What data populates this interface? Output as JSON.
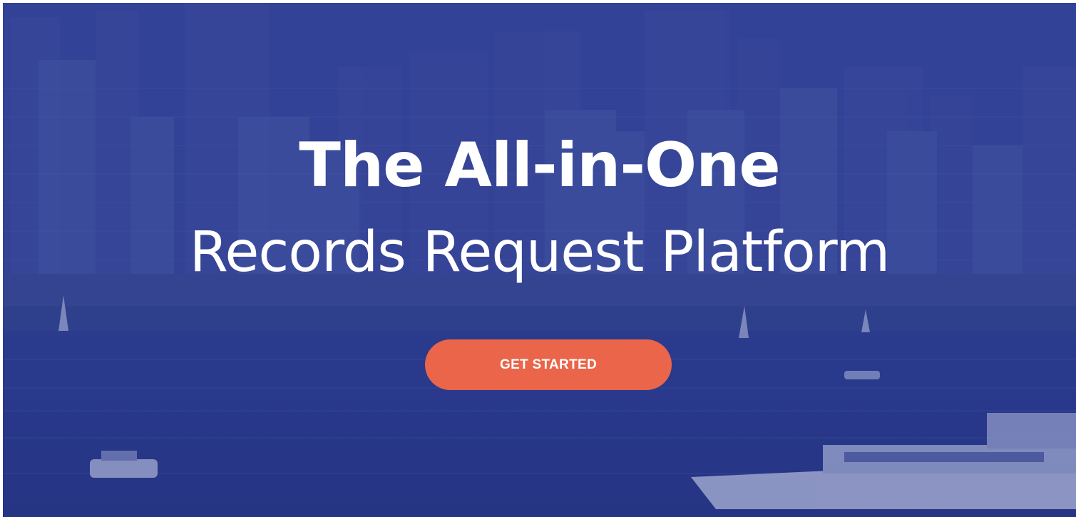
{
  "hero": {
    "headline_bold": "The All-in-One",
    "headline_light": "Records Request Platform",
    "cta_label": "GET STARTED"
  },
  "colors": {
    "overlay": "#24348c",
    "cta_background": "#ea6549",
    "text": "#ffffff"
  }
}
